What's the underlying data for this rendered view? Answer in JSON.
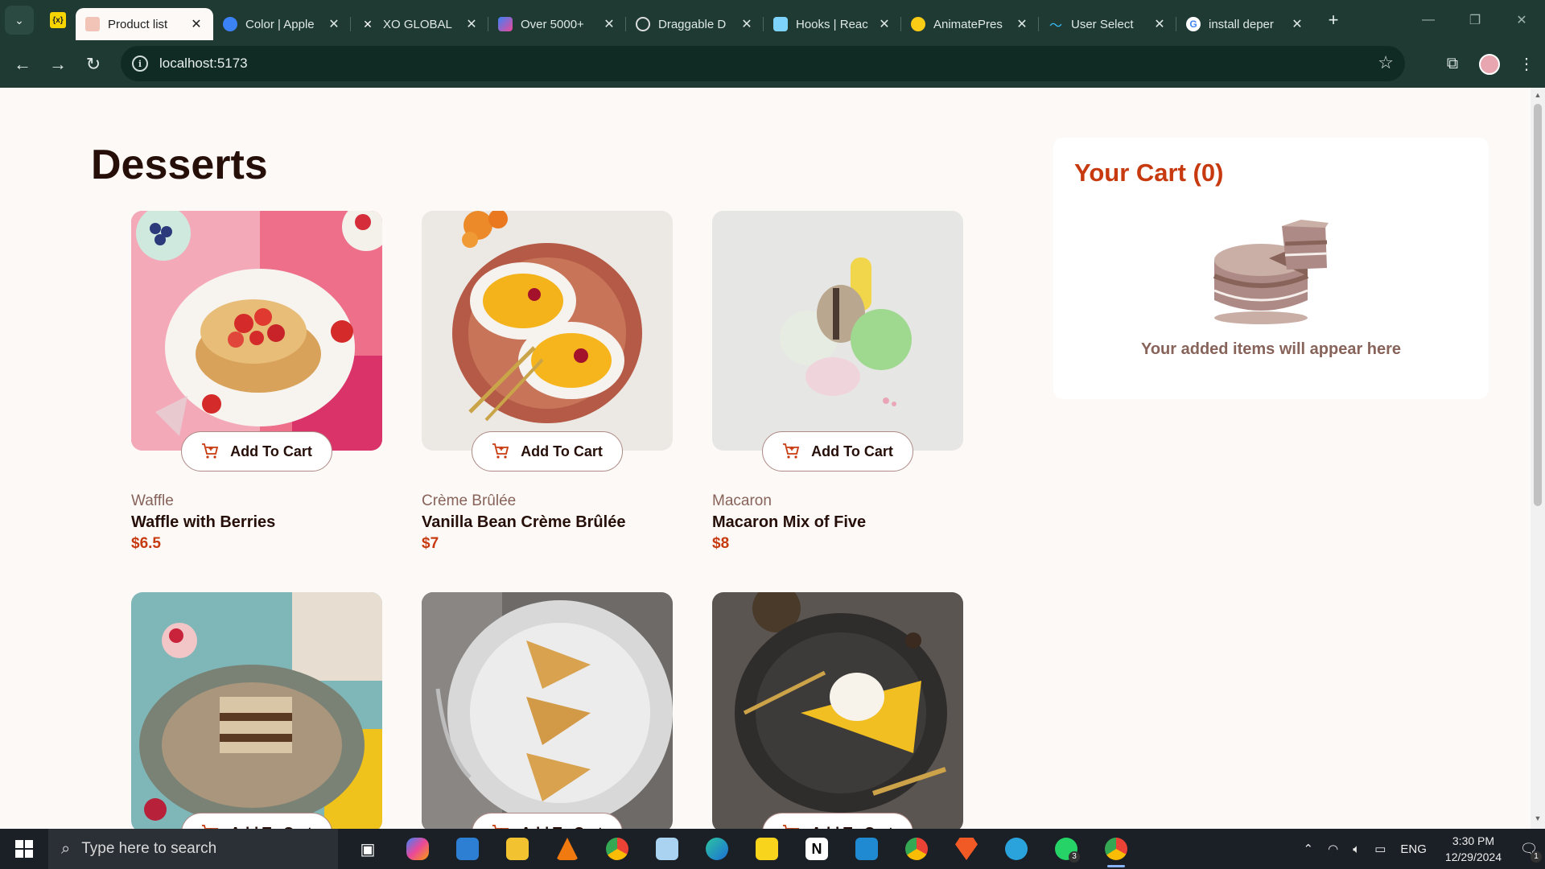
{
  "browser": {
    "tabs": [
      {
        "title": "Product list",
        "active": true,
        "icon": "dessert-favicon",
        "color": "#c73a0f"
      },
      {
        "title": "Color | Apple",
        "icon": "apple-favicon",
        "color": "#3b82f6"
      },
      {
        "title": "XO GLOBAL",
        "icon": "xo-favicon",
        "color": "#ffffff"
      },
      {
        "title": "Over 5000+",
        "icon": "gradient-favicon",
        "color": "#7c3aed"
      },
      {
        "title": "Draggable D",
        "icon": "openai-favicon",
        "color": "#dddddd"
      },
      {
        "title": "Hooks | Reac",
        "icon": "react-favicon",
        "color": "#7dd3fc"
      },
      {
        "title": "AnimatePres",
        "icon": "framer-favicon",
        "color": "#facc15"
      },
      {
        "title": "User Select",
        "icon": "tailwind-favicon",
        "color": "#38bdf8"
      },
      {
        "title": "install deper",
        "icon": "google-favicon",
        "color": "#ffffff"
      }
    ],
    "pinned_tab_label": "{x}",
    "url": "localhost:5173"
  },
  "page": {
    "heading": "Desserts",
    "add_to_cart_label": "Add To Cart",
    "products": [
      {
        "category": "Waffle",
        "name": "Waffle with Berries",
        "price": "$6.5"
      },
      {
        "category": "Crème Brûlée",
        "name": "Vanilla Bean Crème Brûlée",
        "price": "$7"
      },
      {
        "category": "Macaron",
        "name": "Macaron Mix of Five",
        "price": "$8"
      },
      {
        "category": "",
        "name": "",
        "price": ""
      },
      {
        "category": "",
        "name": "",
        "price": ""
      },
      {
        "category": "",
        "name": "",
        "price": ""
      }
    ],
    "cart": {
      "title": "Your Cart (0)",
      "empty_message": "Your added items will appear here"
    }
  },
  "taskbar": {
    "search_placeholder": "Type here to search",
    "language": "ENG",
    "time": "3:30 PM",
    "date": "12/29/2024",
    "whatsapp_badge": "3",
    "notification_badge": "1"
  },
  "colors": {
    "accent": "#c73a0f",
    "text_dark": "#260f08",
    "text_muted": "#87635a",
    "browser_frame": "#1e3a33"
  }
}
